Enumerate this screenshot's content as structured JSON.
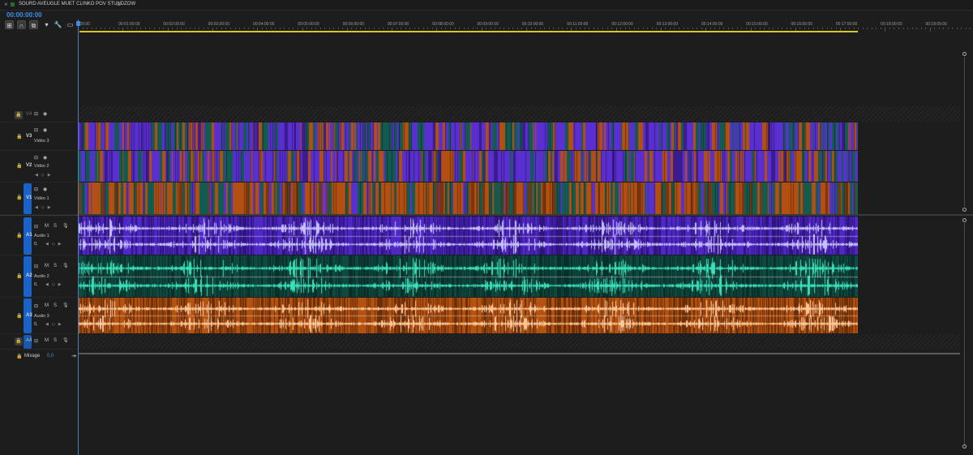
{
  "window": {
    "title": "SOURD AVEUGLE MUET CLINKO POV STUNDZOW",
    "menu_icon": "hamburger-icon"
  },
  "timecode": "00:00:00:00",
  "ruler": {
    "labels": [
      ":00:00",
      "00:01:00:00",
      "00:02:00:00",
      "00:03:00:00",
      "00:04:00:00",
      "00:05:00:00",
      "00:06:00:00",
      "00:07:00:00",
      "00:08:00:00",
      "00:09:00:00",
      "00:10:00:00",
      "00:11:00:00",
      "00:12:00:00",
      "00:13:00:00",
      "00:14:00:00",
      "00:15:00:00",
      "00:16:00:00",
      "00:17:00:00",
      "00:18:00:00",
      "00:19:00:00"
    ]
  },
  "tools": [
    "nest-sequence-icon",
    "snap-icon",
    "linked-selection-icon",
    "add-marker-icon",
    "wrench-icon",
    "captions-icon"
  ],
  "video_tracks": [
    {
      "id": "V4",
      "name": "",
      "empty": true
    },
    {
      "id": "V3",
      "name": "Vidéo 3",
      "targeted": false
    },
    {
      "id": "V2",
      "name": "Vidéo 2",
      "targeted": false
    },
    {
      "id": "V1",
      "name": "Vidéo 1",
      "targeted": true
    }
  ],
  "audio_tracks": [
    {
      "id": "A1",
      "name": "Audio 1",
      "targeted": true,
      "m": "M",
      "s": "S",
      "vol": "0,"
    },
    {
      "id": "A2",
      "name": "Audio 2",
      "targeted": true,
      "m": "M",
      "s": "S",
      "vol": "0,"
    },
    {
      "id": "A3",
      "name": "Audio 3",
      "targeted": true,
      "m": "M",
      "s": "S",
      "vol": "0,"
    },
    {
      "id": "A4",
      "name": "",
      "empty": true,
      "m": "M",
      "s": "S"
    }
  ],
  "mix": {
    "label": "Mixage",
    "value": "0,0"
  },
  "colors": {
    "accent": "#3d8ff0",
    "purple": "#5a2fd0",
    "teal": "#135b50",
    "orange": "#b24f12",
    "work_area": "#d8c72a"
  }
}
